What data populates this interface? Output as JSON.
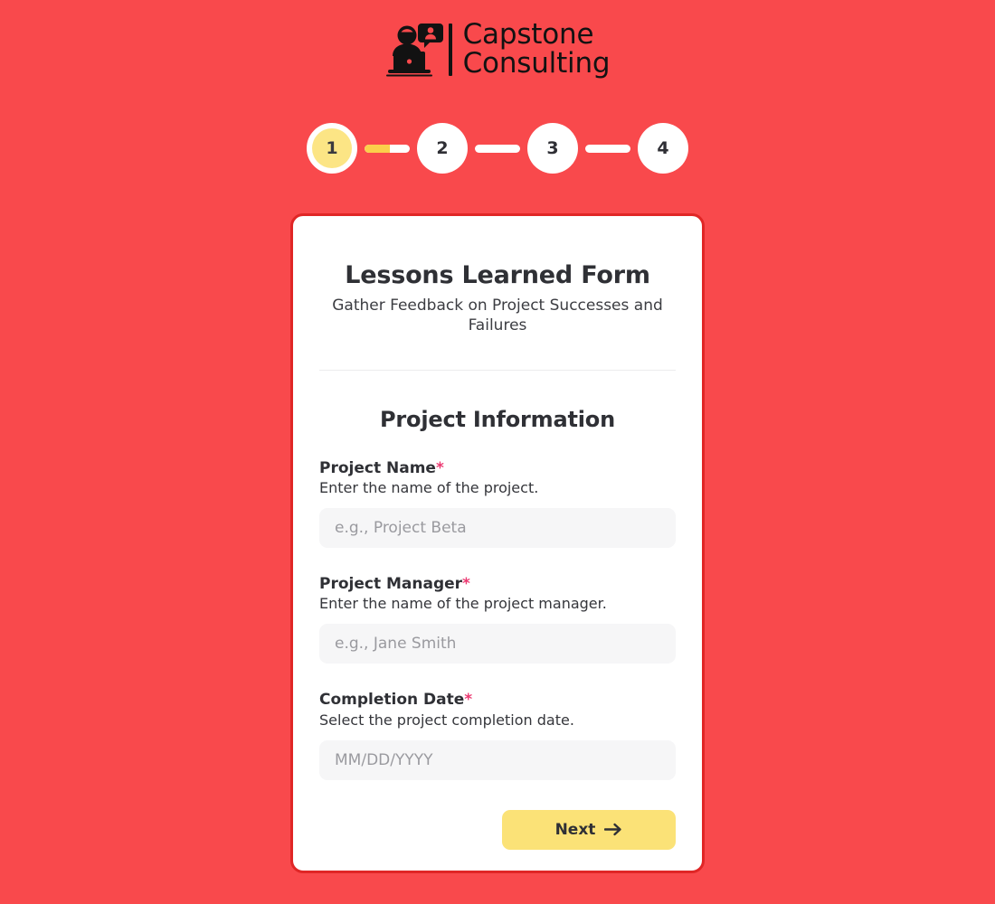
{
  "brand": {
    "name_line1": "Capstone",
    "name_line2": "Consulting",
    "logo_icon": "person-at-laptop-with-chat-bubble-icon"
  },
  "stepper": {
    "steps": [
      {
        "label": "1",
        "state": "active"
      },
      {
        "label": "2",
        "state": "inactive"
      },
      {
        "label": "3",
        "state": "inactive"
      },
      {
        "label": "4",
        "state": "inactive"
      }
    ],
    "connectors": [
      {
        "progress_percent": 55
      },
      {
        "progress_percent": 0
      },
      {
        "progress_percent": 0
      }
    ],
    "active_color": "#fce585",
    "progress_color": "#fbcf4b",
    "track_color": "#ffffff"
  },
  "card": {
    "title": "Lessons Learned Form",
    "subtitle": "Gather Feedback on Project Successes and Failures",
    "section_title": "Project Information",
    "border_color": "#e02626",
    "fields": [
      {
        "label": "Project Name",
        "required_marker": "*",
        "help": "Enter the name of the project.",
        "placeholder": "e.g., Project Beta",
        "value": "",
        "type": "text"
      },
      {
        "label": "Project Manager",
        "required_marker": "*",
        "help": "Enter the name of the project manager.",
        "placeholder": "e.g., Jane Smith",
        "value": "",
        "type": "text"
      },
      {
        "label": "Completion Date",
        "required_marker": "*",
        "help": "Select the project completion date.",
        "placeholder": "MM/DD/YYYY",
        "value": "",
        "type": "date"
      }
    ],
    "next_label": "Next",
    "next_icon": "arrow-right-icon",
    "next_color": "#fbe277"
  },
  "page": {
    "background_color": "#f9494c",
    "required_marker_color": "#ec3a72"
  }
}
